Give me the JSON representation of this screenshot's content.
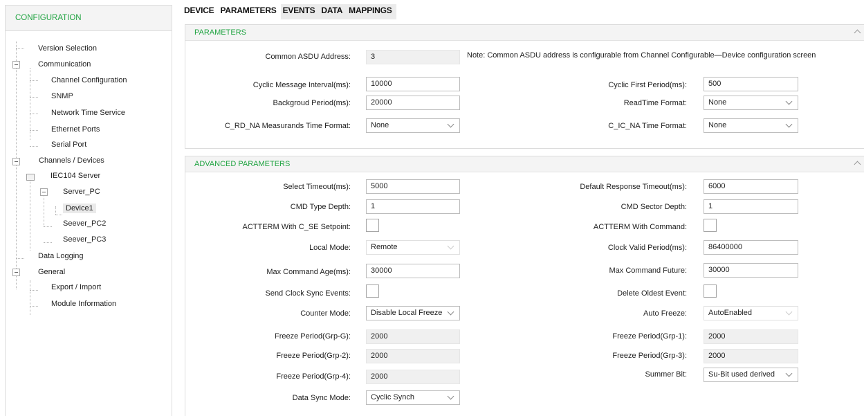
{
  "sidebar": {
    "header": "CONFIGURATION",
    "items": {
      "version_selection": "Version Selection",
      "communication": "Communication",
      "channel_configuration": "Channel Configuration",
      "snmp": "SNMP",
      "network_time_service": "Network Time Service",
      "ethernet_ports": "Ethernet Ports",
      "serial_port": "Serial Port",
      "channels_devices": "Channels / Devices",
      "iec104_server": "IEC104 Server",
      "server_pc": "Server_PC",
      "device1": "Device1",
      "seever_pc2": "Seever_PC2",
      "seever_pc3": "Seever_PC3",
      "data_logging": "Data Logging",
      "general": "General",
      "export_import": "Export / Import",
      "module_information": "Module Information"
    }
  },
  "tabs": [
    "DEVICE",
    "PARAMETERS",
    "EVENTS",
    "DATA",
    "MAPPINGS"
  ],
  "parameters": {
    "title": "PARAMETERS",
    "common_asdu_label": "Common ASDU Address:",
    "common_asdu_value": "3",
    "note": "Note: Common ASDU address is configurable from Channel Configurable—Device configuration screen",
    "cyclic_interval_label": "Cyclic Message Interval(ms):",
    "cyclic_interval_value": "10000",
    "cyclic_first_label": "Cyclic First Period(ms):",
    "cyclic_first_value": "500",
    "background_label": "Backgroud Period(ms):",
    "background_value": "20000",
    "readtime_label": "ReadTime Format:",
    "readtime_value": "None",
    "c_rd_label": "C_RD_NA Measurands Time Format:",
    "c_rd_value": "None",
    "c_ic_label": "C_IC_NA Time Format:",
    "c_ic_value": "None"
  },
  "advanced": {
    "title": "ADVANCED PARAMETERS",
    "select_timeout_label": "Select Timeout(ms):",
    "select_timeout_value": "5000",
    "default_response_label": "Default Response Timeout(ms):",
    "default_response_value": "6000",
    "cmd_type_label": "CMD Type Depth:",
    "cmd_type_value": "1",
    "cmd_sector_label": "CMD Sector Depth:",
    "cmd_sector_value": "1",
    "actterm_cse_label": "ACTTERM With C_SE Setpoint:",
    "actterm_cmd_label": "ACTTERM With Command:",
    "local_mode_label": "Local Mode:",
    "local_mode_value": "Remote",
    "clock_valid_label": "Clock Valid Period(ms):",
    "clock_valid_value": "86400000",
    "max_age_label": "Max Command Age(ms):",
    "max_age_value": "30000",
    "max_future_label": "Max Command Future:",
    "max_future_value": "30000",
    "send_clock_label": "Send Clock Sync Events:",
    "delete_oldest_label": "Delete Oldest Event:",
    "counter_mode_label": "Counter Mode:",
    "counter_mode_value": "Disable Local Freeze",
    "auto_freeze_label": "Auto Freeze:",
    "auto_freeze_value": "AutoEnabled",
    "fp_g_label": "Freeze Period(Grp-G):",
    "fp_g_value": "2000",
    "fp_1_label": "Freeze Period(Grp-1):",
    "fp_1_value": "2000",
    "fp_2_label": "Freeze Period(Grp-2):",
    "fp_2_value": "2000",
    "fp_3_label": "Freeze Period(Grp-3):",
    "fp_3_value": "2000",
    "fp_4_label": "Freeze Period(Grp-4):",
    "fp_4_value": "2000",
    "summer_bit_label": "Summer Bit:",
    "summer_bit_value": "Su-Bit used derived",
    "data_sync_label": "Data Sync Mode:",
    "data_sync_value": "Cyclic Synch"
  },
  "colors": {
    "accent_green": "#21a442",
    "header_bg": "#f4f4f4"
  },
  "icons": [
    "tree-collapse-icon",
    "folder-icon",
    "chevron-down-icon",
    "chevron-up-icon"
  ]
}
